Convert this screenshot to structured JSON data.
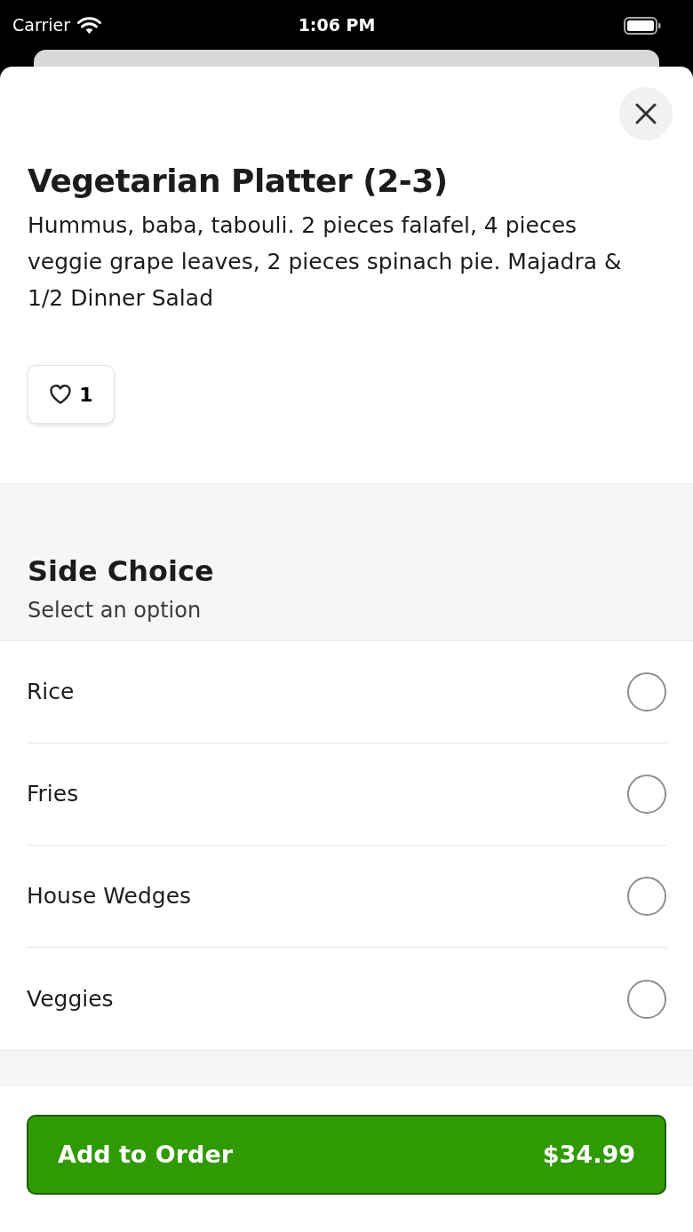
{
  "status_bar": {
    "carrier": "Carrier",
    "time": "1:06 PM"
  },
  "item": {
    "title": "Vegetarian Platter (2-3)",
    "description": "Hummus, baba, tabouli. 2 pieces falafel, 4 pieces veggie grape leaves, 2 pieces spinach pie. Majadra & 1/2 Dinner Salad",
    "likes": "1"
  },
  "section": {
    "title": "Side Choice",
    "subtitle": "Select an option"
  },
  "options": [
    {
      "label": "Rice",
      "selected": false
    },
    {
      "label": "Fries",
      "selected": false
    },
    {
      "label": "House Wedges",
      "selected": false
    },
    {
      "label": "Veggies",
      "selected": false
    }
  ],
  "order_button": {
    "label": "Add to Order",
    "price": "$34.99"
  }
}
